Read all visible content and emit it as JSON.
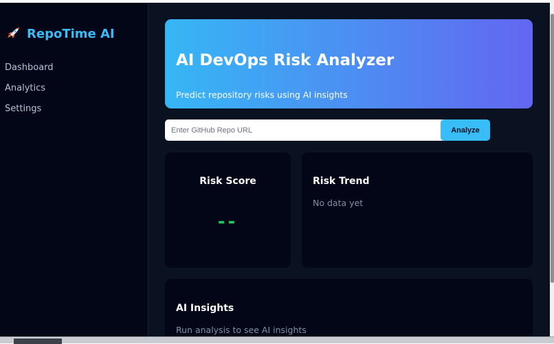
{
  "sidebar": {
    "brand": "RepoTime AI",
    "brand_icon": "rocket-icon",
    "items": [
      {
        "label": "Dashboard"
      },
      {
        "label": "Analytics"
      },
      {
        "label": "Settings"
      }
    ]
  },
  "hero": {
    "title": "AI DevOps Risk Analyzer",
    "subtitle": "Predict repository risks using AI insights"
  },
  "search": {
    "placeholder": "Enter GitHub Repo URL",
    "button_label": "Analyze"
  },
  "risk_score": {
    "title": "Risk Score",
    "value": "--"
  },
  "risk_trend": {
    "title": "Risk Trend",
    "empty_text": "No data yet"
  },
  "insights": {
    "title": "AI Insights",
    "empty_text": "Run analysis to see AI insights"
  },
  "colors": {
    "accent": "#38bdf8",
    "score": "#22c55e",
    "hero_gradient_start": "#36b7f5",
    "hero_gradient_end": "#6366f1",
    "background": "#0a1120",
    "card": "#020617"
  }
}
